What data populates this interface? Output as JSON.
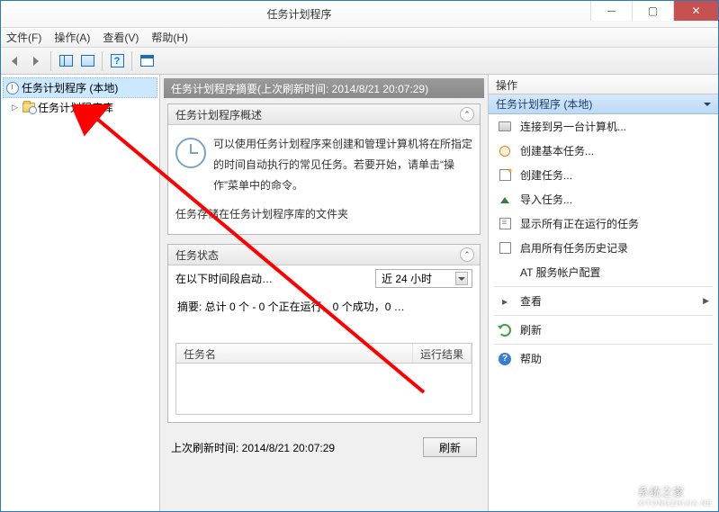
{
  "window": {
    "title": "任务计划程序"
  },
  "menu": {
    "file": "文件(F)",
    "action": "操作(A)",
    "view": "查看(V)",
    "help": "帮助(H)"
  },
  "tree": {
    "root": "任务计划程序 (本地)",
    "library": "任务计划程序库"
  },
  "center": {
    "summary_header": "任务计划程序摘要(上次刷新时间: 2014/8/21 20:07:29)",
    "overview_title": "任务计划程序概述",
    "overview_text": "可以使用任务计划程序来创建和管理计算机将在所指定的时间自动执行的常见任务。若要开始，请单击“操作”菜单中的命令。",
    "overview_tail": "任务存储在任务计划程序库的文件夹",
    "status_title": "任务状态",
    "status_label": "在以下时间段启动…",
    "status_dropdown": "近 24 小时",
    "summary_line": "摘要: 总计 0 个 - 0 个正在运行，0 个成功，0 …",
    "col_name": "任务名",
    "col_result": "运行结果",
    "last_refresh": "上次刷新时间: 2014/8/21 20:07:29",
    "refresh_btn": "刷新"
  },
  "actions": {
    "pane_title": "操作",
    "group_title": "任务计划程序 (本地)",
    "items": {
      "connect": "连接到另一台计算机...",
      "basic": "创建基本任务...",
      "create": "创建任务...",
      "import": "导入任务...",
      "running": "显示所有正在运行的任务",
      "history": "启用所有任务历史记录",
      "at": "AT 服务帐户配置",
      "view": "查看",
      "refresh": "刷新",
      "help": "帮助"
    }
  },
  "watermark": {
    "text": "系统之家",
    "sub": "XITONGZHIJIA.NE"
  }
}
